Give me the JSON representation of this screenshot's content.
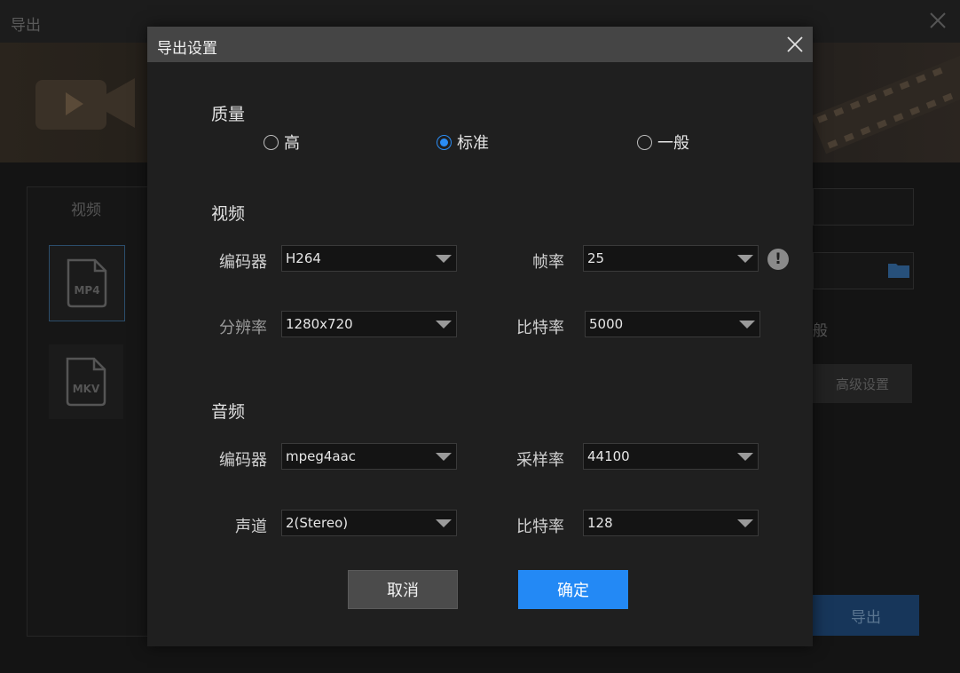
{
  "background": {
    "window_title": "导出",
    "tab_video": "视频",
    "formats": [
      {
        "label": "MP4"
      },
      {
        "label": "MKV"
      }
    ],
    "general_partial": "般",
    "advanced_button": "高级设置",
    "export_button": "导出"
  },
  "dialog": {
    "title": "导出设置",
    "quality": {
      "title": "质量",
      "options": [
        "高",
        "标准",
        "一般"
      ],
      "selected": "标准"
    },
    "video": {
      "title": "视频",
      "encoder_label": "编码器",
      "encoder_value": "H264",
      "framerate_label": "帧率",
      "framerate_value": "25",
      "resolution_label": "分辨率",
      "resolution_value": "1280x720",
      "bitrate_label": "比特率",
      "bitrate_value": "5000"
    },
    "audio": {
      "title": "音频",
      "encoder_label": "编码器",
      "encoder_value": "mpeg4aac",
      "samplerate_label": "采样率",
      "samplerate_value": "44100",
      "channel_label": "声道",
      "channel_value": "2(Stereo)",
      "bitrate_label": "比特率",
      "bitrate_value": "128"
    },
    "cancel_label": "取消",
    "ok_label": "确定"
  },
  "colors": {
    "accent": "#2389f5",
    "dialog_bg": "#1f1f1f",
    "titlebar_bg": "#454545"
  }
}
